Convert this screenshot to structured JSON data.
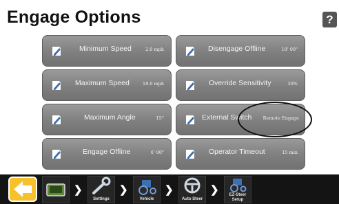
{
  "header": {
    "title": "Engage Options",
    "help_icon": "question-mark-icon",
    "help_label": "?"
  },
  "options": [
    {
      "label": "Minimum Speed",
      "value": "2.0 mph"
    },
    {
      "label": "Disengage Offline",
      "value": "18' 00\""
    },
    {
      "label": "Maximum Speed",
      "value": "18.0 mph"
    },
    {
      "label": "Override Sensitivity",
      "value": "30%"
    },
    {
      "label": "Maximum Angle",
      "value": "15°"
    },
    {
      "label": "External Switch",
      "value": "Remote Engage"
    },
    {
      "label": "Engage Offline",
      "value": "6' 00\""
    },
    {
      "label": "Operator Timeout",
      "value": "15 min"
    }
  ],
  "colors": {
    "back_button": "#f6c12a",
    "bottom_bar": "#141414",
    "option_button": "#8a8a8a"
  },
  "breadcrumbs": [
    {
      "label": "",
      "icon": "display-monitor-icon"
    },
    {
      "label": "Settings",
      "icon": "wrench-icon"
    },
    {
      "label": "Vehicle",
      "icon": "tractor-icon"
    },
    {
      "label": "Auto Steer",
      "icon": "steering-wheel-icon"
    },
    {
      "label": "EZ-Steer Setup",
      "icon": "tractor-icon"
    }
  ]
}
